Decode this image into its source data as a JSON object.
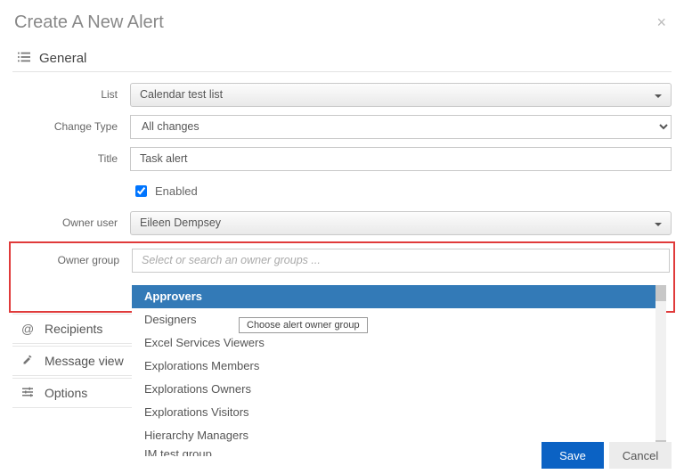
{
  "dialog": {
    "title": "Create A New Alert"
  },
  "section_general": {
    "label": "General"
  },
  "fields": {
    "list": {
      "label": "List",
      "value": "Calendar test list"
    },
    "change_type": {
      "label": "Change Type",
      "value": "All changes"
    },
    "title": {
      "label": "Title",
      "value": "Task alert"
    },
    "enabled": {
      "label": "Enabled",
      "checked": true
    },
    "owner_user": {
      "label": "Owner user",
      "value": "Eileen Dempsey"
    },
    "owner_group": {
      "label": "Owner group",
      "placeholder": "Select or search an owner groups ...",
      "tooltip": "Choose alert owner group",
      "options": [
        "Approvers",
        "Designers",
        "Excel Services Viewers",
        "Explorations Members",
        "Explorations Owners",
        "Explorations Visitors",
        "Hierarchy Managers"
      ],
      "cutoff": "IM test group",
      "selected_index": 0
    }
  },
  "side_sections": {
    "recipients": "Recipients",
    "message_view": "Message view",
    "options": "Options"
  },
  "footer": {
    "save": "Save",
    "cancel": "Cancel"
  }
}
